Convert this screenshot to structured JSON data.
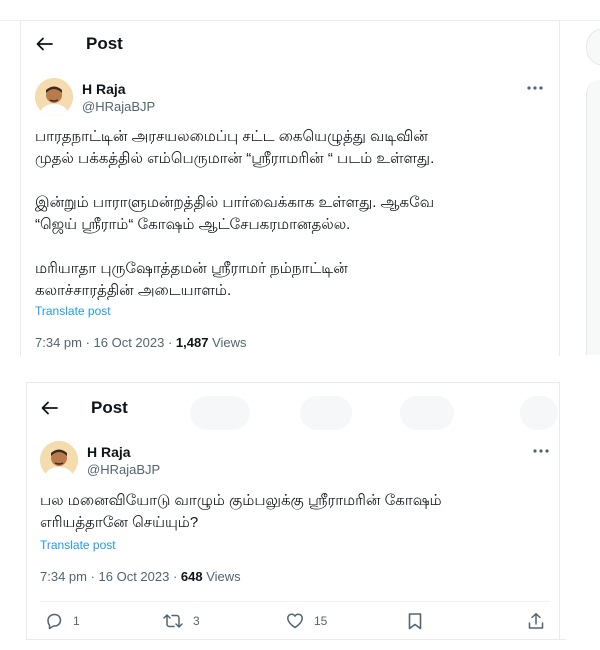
{
  "colors": {
    "accent": "#1d9bf0",
    "text_primary": "#0f1419",
    "text_secondary": "#536471"
  },
  "tweet1": {
    "header_title": "Post",
    "author_name": "H Raja",
    "author_handle": "@HRajaBJP",
    "paragraphs": [
      [
        "பாரதநாட்டின் அரசயலமைப்பு சட்ட கையெழுத்து வடிவின்",
        "முதல் பக்கத்தில் எம்பெருமான் “ஸ்ரீராமரின் “ படம் உள்ளது."
      ],
      [
        "இன்றும் பாராளுமன்றத்தில் பார்வைக்காக உள்ளது. ஆகவே",
        "“ஜெய் ஸ்ரீராம்“ கோஷம் ஆட்சேபகரமானதல்ல."
      ],
      [
        "மரியாதா புருஷோத்தமன் ஸ்ரீராமர் நம்நாட்டின்",
        "கலாச்சாரத்தின் அடையாளம்."
      ]
    ],
    "translate_label": "Translate post",
    "timestamp": "7:34 pm · 16 Oct 2023 · ",
    "views_count": "1,487",
    "views_label": " Views"
  },
  "tweet2": {
    "header_title": "Post",
    "author_name": "H Raja",
    "author_handle": "@HRajaBJP",
    "lines": [
      "பல மனைவியோடு வாழும் கும்பலுக்கு ஸ்ரீராமரின் கோஷம்",
      "எரியத்தானே செய்யும்?"
    ],
    "translate_label": "Translate post",
    "timestamp": "7:34 pm · 16 Oct 2023 · ",
    "views_count": "648",
    "views_label": " Views",
    "actions": {
      "replies": "1",
      "reposts": "3",
      "likes": "15"
    }
  },
  "icons": {
    "back": "arrow-left-icon",
    "more": "more-horizontal-icon",
    "reply": "reply-icon",
    "repost": "repost-icon",
    "like": "heart-icon",
    "bookmark": "bookmark-icon",
    "share": "share-icon"
  }
}
